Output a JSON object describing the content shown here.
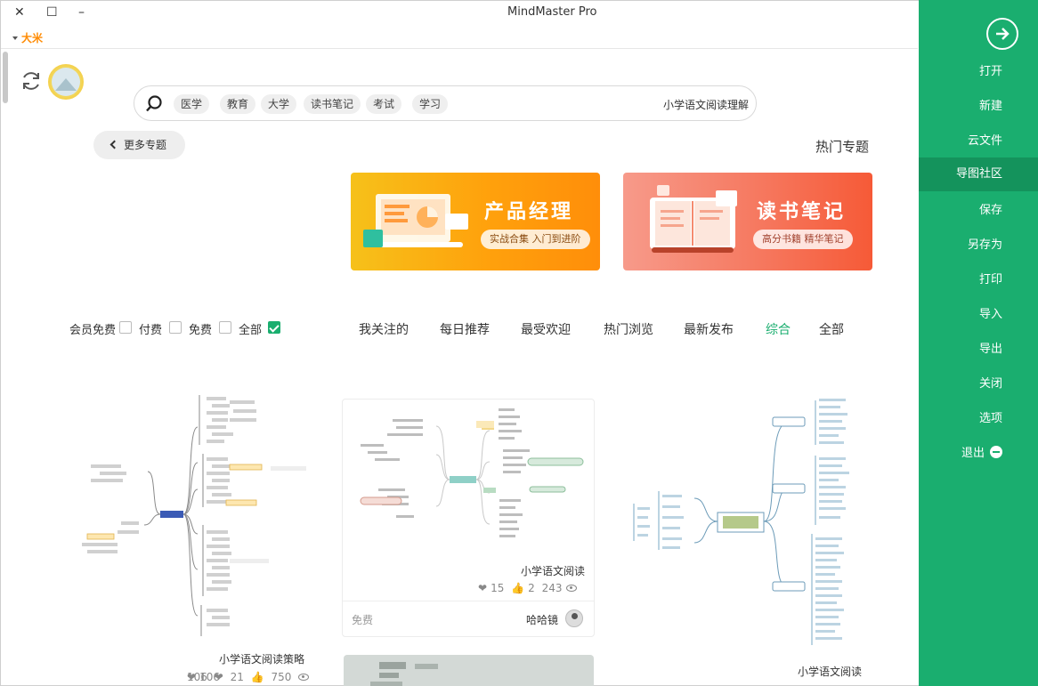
{
  "window": {
    "title": "MindMaster Pro",
    "controls": {
      "close": "✕",
      "maximize": "☐",
      "minimize": "–"
    },
    "user_label": "大米"
  },
  "sidebar": {
    "items": [
      {
        "label": "打开"
      },
      {
        "label": "新建"
      },
      {
        "label": "云文件"
      },
      {
        "label": "导图社区",
        "active": true
      },
      {
        "label": "保存"
      },
      {
        "label": "另存为"
      },
      {
        "label": "打印"
      },
      {
        "label": "导入"
      },
      {
        "label": "导出"
      },
      {
        "label": "关闭"
      },
      {
        "label": "选项"
      },
      {
        "label": "退出"
      }
    ],
    "accent": "#1aae6f"
  },
  "search": {
    "value": "小学语文阅读理解",
    "chips": [
      "学习",
      "考试",
      "读书笔记",
      "大学",
      "教育",
      "医学"
    ]
  },
  "hot_topics": {
    "title": "热门专题",
    "more_label": "更多专题"
  },
  "banners": [
    {
      "title": "读书笔记",
      "subtitle": "高分书籍 精华笔记",
      "icon": "book-icon"
    },
    {
      "title": "产品经理",
      "subtitle": "实战合集 入门到进阶",
      "icon": "laptop-chart-icon"
    }
  ],
  "tabs": [
    "全部",
    "综合",
    "最新发布",
    "热门浏览",
    "最受欢迎",
    "每日推荐",
    "我关注的"
  ],
  "active_tab": "综合",
  "filters": [
    {
      "label": "全部",
      "checked": true
    },
    {
      "label": "免费",
      "checked": false
    },
    {
      "label": "付费",
      "checked": false
    },
    {
      "label": "会员免费",
      "checked": false
    }
  ],
  "cards": [
    {
      "title": "小学语文阅读"
    },
    {
      "title": "小学语文阅读",
      "views": "243",
      "likes": "2",
      "favorites": "15",
      "author": "哈哈镜",
      "price": "免费"
    },
    {
      "title": "小学语文阅读策略",
      "views": "750",
      "likes": "21",
      "favorites": "106"
    }
  ]
}
